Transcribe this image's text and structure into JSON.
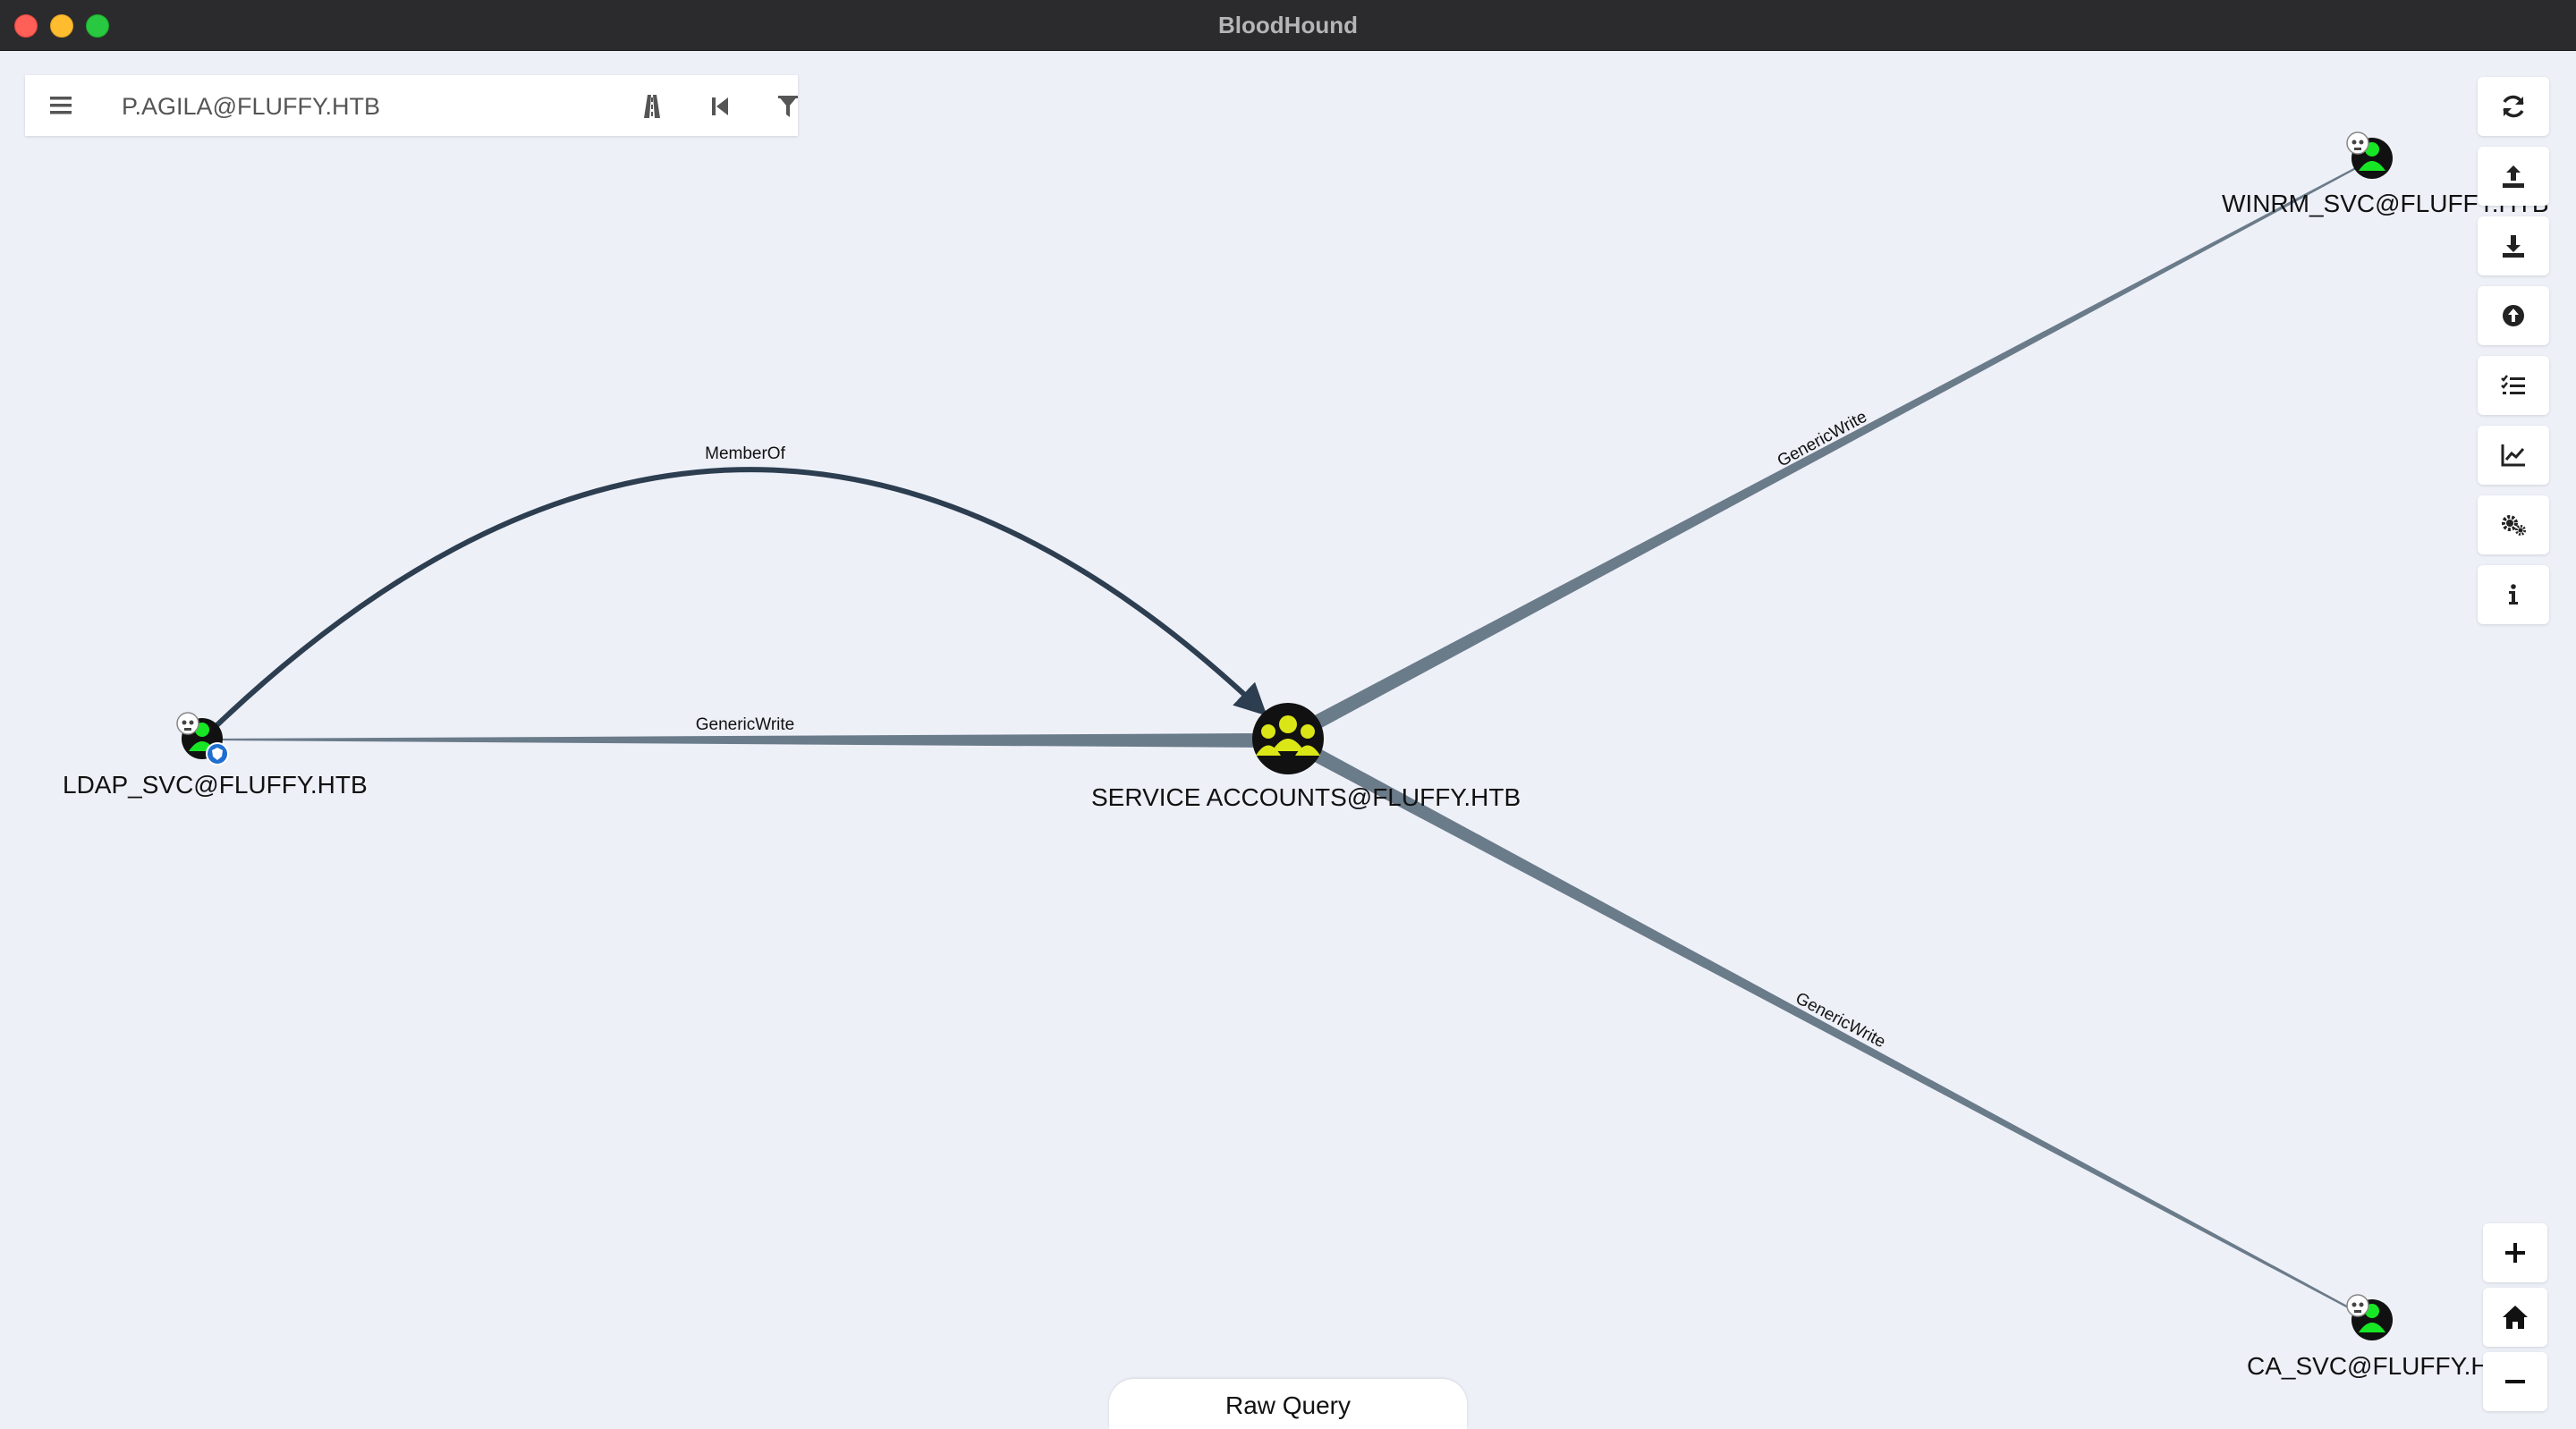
{
  "window": {
    "title": "BloodHound"
  },
  "search": {
    "value": "P.AGILA@FLUFFY.HTB"
  },
  "graph": {
    "nodes": [
      {
        "id": "ldap",
        "label": "LDAP_SVC@FLUFFY.HTB",
        "type": "user",
        "owned": true,
        "high_value": true
      },
      {
        "id": "svcacc",
        "label": "SERVICE ACCOUNTS@FLUFFY.HTB",
        "type": "group"
      },
      {
        "id": "winrm",
        "label": "WINRM_SVC@FLUFFY.HTB",
        "type": "user",
        "owned": true
      },
      {
        "id": "ca",
        "label": "CA_SVC@FLUFFY.HTB",
        "type": "user",
        "owned": true
      }
    ],
    "edges": [
      {
        "from": "ldap",
        "to": "svcacc",
        "label": "MemberOf"
      },
      {
        "from": "ldap",
        "to": "svcacc",
        "label": "GenericWrite"
      },
      {
        "from": "svcacc",
        "to": "winrm",
        "label": "GenericWrite"
      },
      {
        "from": "svcacc",
        "to": "ca",
        "label": "GenericWrite"
      }
    ]
  },
  "toolbar": {
    "right_buttons": [
      "refresh-icon",
      "upload-icon",
      "download-icon",
      "import-icon",
      "query-list-icon",
      "analytics-chart-icon",
      "settings-gears-icon",
      "info-icon"
    ],
    "zoom_buttons": [
      "zoom-in-icon",
      "home-icon",
      "zoom-out-icon"
    ]
  },
  "raw_query": {
    "label": "Raw Query"
  },
  "colors": {
    "background": "#eef0f8",
    "edge_member": "#2c3e50",
    "edge_generic": "#6a7b8a",
    "user_node": "#17e625",
    "group_node": "#dbe617",
    "high_value_badge": "#1e6fd0"
  }
}
